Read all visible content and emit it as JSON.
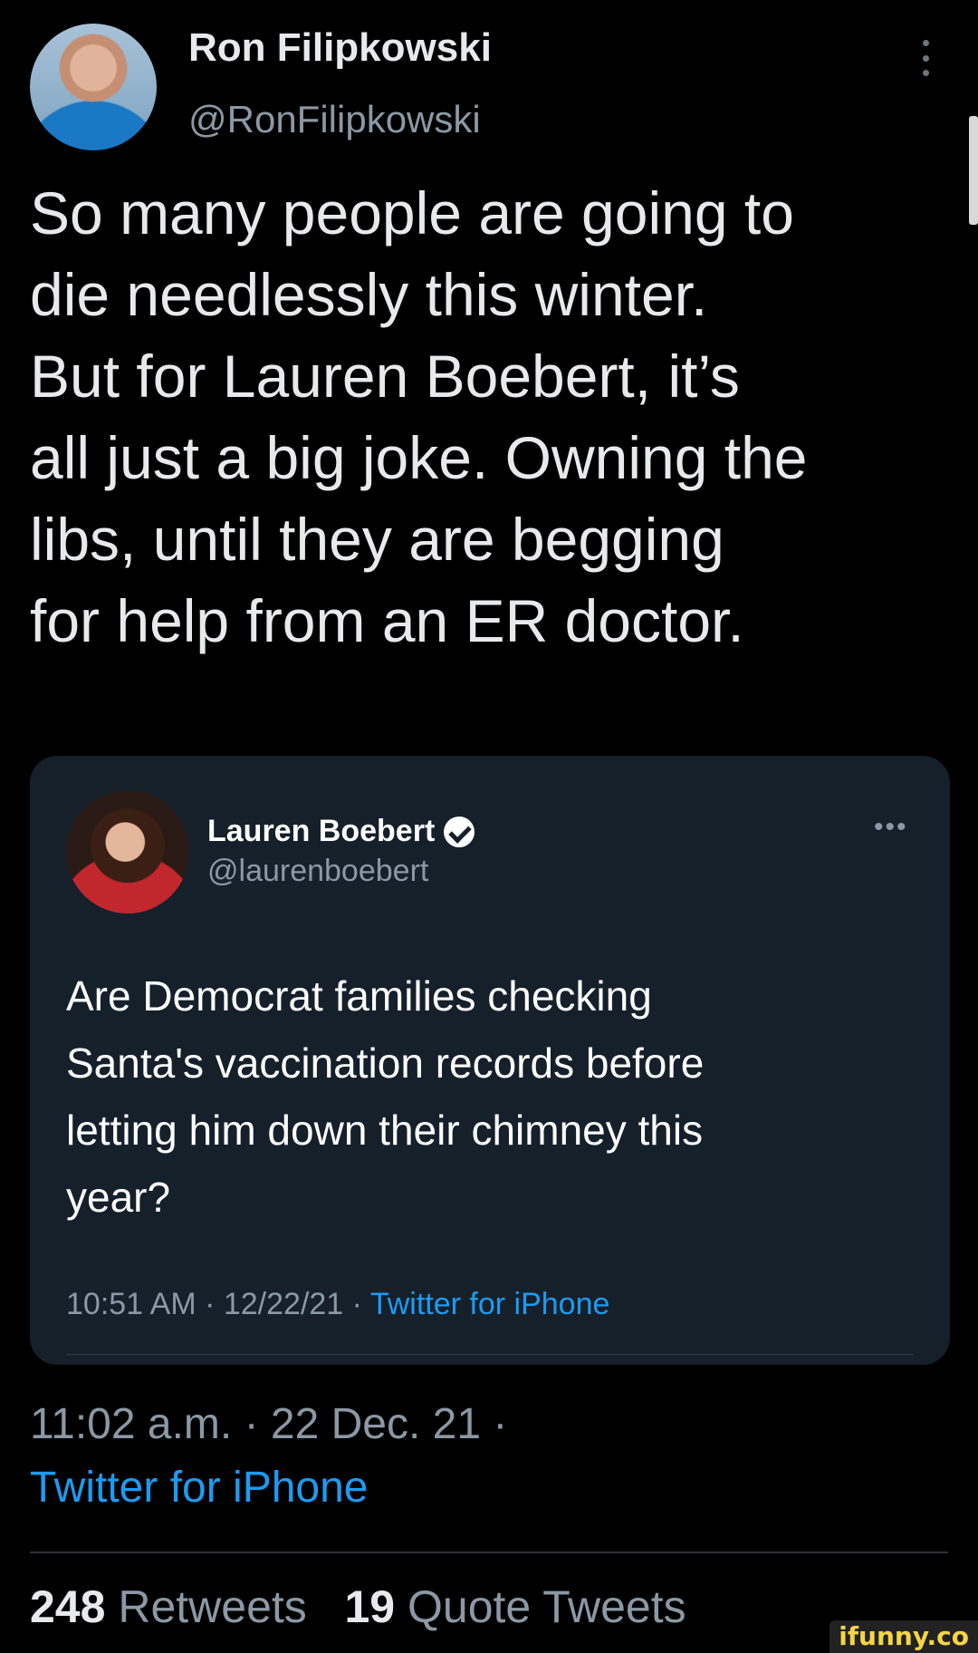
{
  "tweet": {
    "author_name": "Ron Filipkowski",
    "author_handle": "@RonFilipkowski",
    "text": "So many people are going to\ndie needlessly this winter.\nBut for Lauren Boebert, it’s\nall just a big joke. Owning the\nlibs, until they are begging\nfor help from an ER doctor.",
    "timestamp": "11:02 a.m. · 22 Dec. 21 ·",
    "source": "Twitter for iPhone",
    "retweets_count": "248",
    "retweets_label": "Retweets",
    "quotes_count": "19",
    "quotes_label": "Quote Tweets",
    "menu_icon": "vertical-ellipsis-icon"
  },
  "quoted": {
    "author_name": "Lauren Boebert",
    "author_handle": "@laurenboebert",
    "verified_icon": "verified-badge-icon",
    "more_icon": "•••",
    "text": "Are Democrat families checking\nSanta's vaccination records before\nletting him down their chimney this\nyear?",
    "time": "10:51 AM · 12/22/21 · ",
    "source": "Twitter for iPhone"
  },
  "watermark": "ifunny.co",
  "colors": {
    "background": "#000000",
    "card": "#15202b",
    "link": "#1d9bf0",
    "muted": "#8b98a5",
    "text": "#e7e9ea"
  }
}
